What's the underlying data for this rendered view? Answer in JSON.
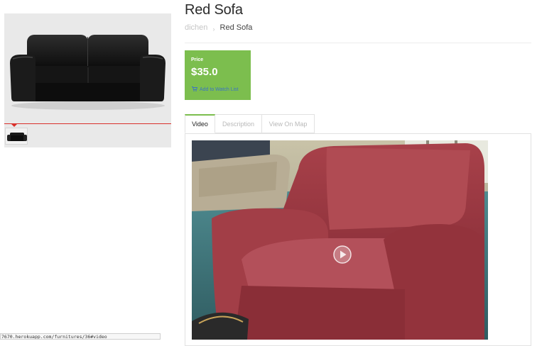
{
  "product": {
    "title": "Red Sofa",
    "main_image": "black-leather-sofa",
    "thumbnails": [
      "black-leather-sofa-thumb"
    ]
  },
  "breadcrumb": {
    "items": [
      {
        "label": "dichen"
      },
      {
        "label": "Red Sofa"
      }
    ],
    "separator": "›"
  },
  "price_box": {
    "label": "Price",
    "value": "$35.0",
    "watch_label": "Add to Watch List",
    "watch_icon": "cart-icon",
    "background": "#7cbe4e",
    "link_color": "#3b72c5"
  },
  "tabs": [
    {
      "label": "Video",
      "active": true
    },
    {
      "label": "Description",
      "active": false
    },
    {
      "label": "View On Map",
      "active": false
    }
  ],
  "video": {
    "subject": "red armchair",
    "control_icon": "play-icon"
  },
  "status_bar": {
    "url": "7670.herokuapp.com/furnitures/36#video"
  },
  "colors": {
    "accent_green": "#7cbe4e",
    "gallery_red": "#d9302b"
  }
}
